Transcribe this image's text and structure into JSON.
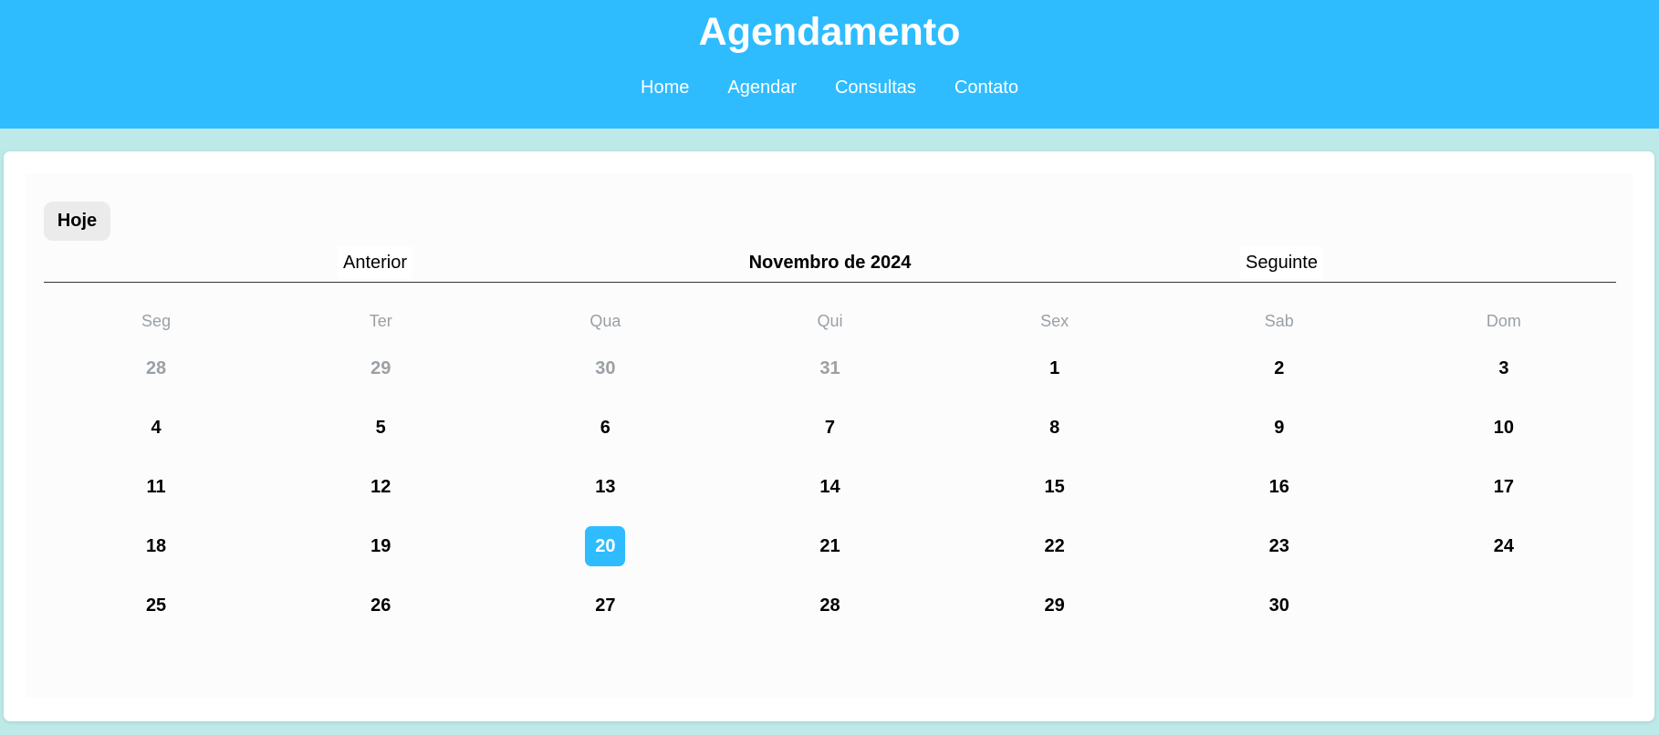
{
  "header": {
    "title": "Agendamento",
    "nav": [
      "Home",
      "Agendar",
      "Consultas",
      "Contato"
    ]
  },
  "calendar": {
    "today_label": "Hoje",
    "prev_label": "Anterior",
    "next_label": "Seguinte",
    "month_label": "Novembro de 2024",
    "weekdays": [
      "Seg",
      "Ter",
      "Qua",
      "Qui",
      "Sex",
      "Sab",
      "Dom"
    ],
    "days": [
      {
        "n": "28",
        "muted": true
      },
      {
        "n": "29",
        "muted": true
      },
      {
        "n": "30",
        "muted": true
      },
      {
        "n": "31",
        "muted": true
      },
      {
        "n": "1"
      },
      {
        "n": "2"
      },
      {
        "n": "3"
      },
      {
        "n": "4"
      },
      {
        "n": "5"
      },
      {
        "n": "6"
      },
      {
        "n": "7"
      },
      {
        "n": "8"
      },
      {
        "n": "9"
      },
      {
        "n": "10"
      },
      {
        "n": "11"
      },
      {
        "n": "12"
      },
      {
        "n": "13"
      },
      {
        "n": "14"
      },
      {
        "n": "15"
      },
      {
        "n": "16"
      },
      {
        "n": "17"
      },
      {
        "n": "18"
      },
      {
        "n": "19"
      },
      {
        "n": "20",
        "selected": true
      },
      {
        "n": "21"
      },
      {
        "n": "22"
      },
      {
        "n": "23"
      },
      {
        "n": "24"
      },
      {
        "n": "25"
      },
      {
        "n": "26"
      },
      {
        "n": "27"
      },
      {
        "n": "28"
      },
      {
        "n": "29"
      },
      {
        "n": "30"
      }
    ]
  },
  "colors": {
    "header_bg": "#2ebcff",
    "page_bg": "#bdeae8",
    "selected_day": "#2ebcff",
    "muted_text": "#9aa0a6"
  }
}
